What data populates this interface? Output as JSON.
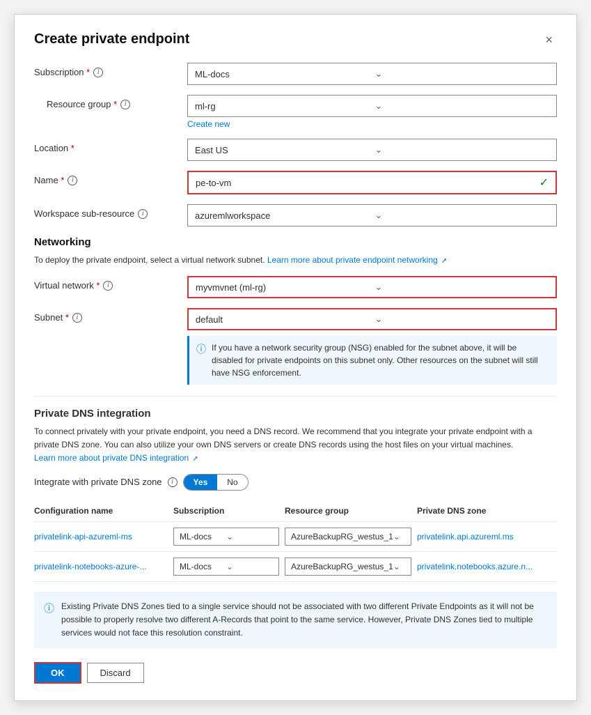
{
  "dialog": {
    "title": "Create private endpoint",
    "close_label": "×"
  },
  "form": {
    "subscription_label": "Subscription",
    "subscription_value": "ML-docs",
    "resource_group_label": "Resource group",
    "resource_group_value": "ml-rg",
    "create_new_label": "Create new",
    "location_label": "Location",
    "location_value": "East US",
    "name_label": "Name",
    "name_value": "pe-to-vm",
    "workspace_label": "Workspace sub-resource",
    "workspace_value": "azuremlworkspace",
    "networking_title": "Networking",
    "networking_desc": "To deploy the private endpoint, select a virtual network subnet.",
    "networking_link": "Learn more about private endpoint networking",
    "virtual_network_label": "Virtual network",
    "virtual_network_value": "myvmvnet (ml-rg)",
    "subnet_label": "Subnet",
    "subnet_value": "default",
    "nsg_info": "If you have a network security group (NSG) enabled for the subnet above, it will be disabled for private endpoints on this subnet only. Other resources on the subnet will still have NSG enforcement.",
    "dns_title": "Private DNS integration",
    "dns_desc1": "To connect privately with your private endpoint, you need a DNS record. We recommend that you integrate your private endpoint with a private DNS zone. You can also utilize your own DNS servers or create DNS records using the host files on your virtual machines.",
    "dns_link": "Learn more about private DNS integration",
    "integrate_label": "Integrate with private DNS zone",
    "toggle_yes": "Yes",
    "toggle_no": "No",
    "table": {
      "headers": [
        "Configuration name",
        "Subscription",
        "Resource group",
        "Private DNS zone"
      ],
      "rows": [
        {
          "config_name": "privatelink-api-azureml-ms",
          "subscription": "ML-docs",
          "resource_group": "AzureBackupRG_westus_1",
          "dns_zone": "privatelink.api.azureml.ms"
        },
        {
          "config_name": "privatelink-notebooks-azure-...",
          "subscription": "ML-docs",
          "resource_group": "AzureBackupRG_westus_1",
          "dns_zone": "privatelink.notebooks.azure.n..."
        }
      ]
    },
    "warning_text": "Existing Private DNS Zones tied to a single service should not be associated with two different Private Endpoints as it will not be possible to properly resolve two different A-Records that point to the same service. However, Private DNS Zones tied to multiple services would not face this resolution constraint.",
    "ok_label": "OK",
    "discard_label": "Discard"
  }
}
